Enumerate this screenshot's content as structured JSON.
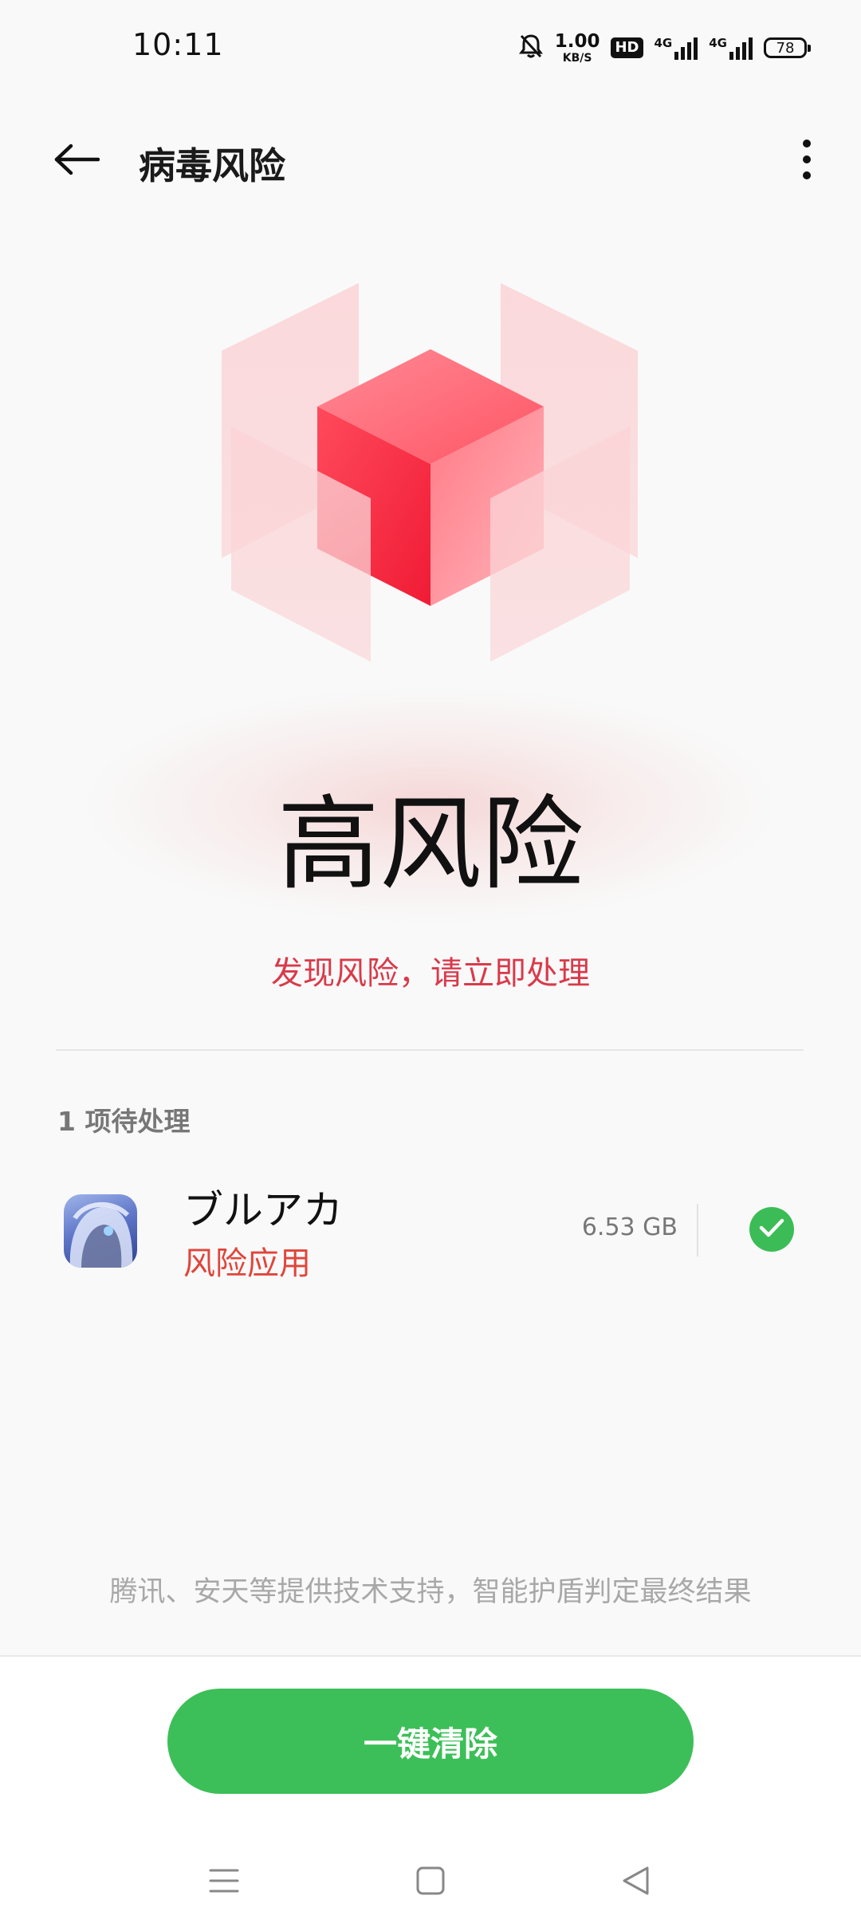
{
  "status_bar": {
    "time": "10:11",
    "net_speed_value": "1.00",
    "net_speed_unit": "KB/S",
    "hd_label": "HD",
    "signal_1_label": "4G",
    "signal_2_label": "4G",
    "battery_level": "78"
  },
  "app_bar": {
    "title": "病毒风险"
  },
  "hero": {
    "risk_level": "高风险",
    "subtitle": "发现风险，请立即处理",
    "accent_color": "#d93a4a"
  },
  "pending": {
    "header": "1 项待处理",
    "items": [
      {
        "name": "ブルアカ",
        "risk_tag": "风险应用",
        "size": "6.53 GB",
        "selected": true
      }
    ]
  },
  "footer": {
    "support_note": "腾讯、安天等提供技术支持，智能护盾判定最终结果",
    "clear_button_label": "一键清除",
    "button_color": "#3cbf58"
  },
  "icons": {
    "back": "arrow-left-icon",
    "more": "more-vertical-icon",
    "check": "check-icon",
    "nav_menu": "menu-icon",
    "nav_home": "home-square-icon",
    "nav_back": "back-triangle-icon"
  }
}
